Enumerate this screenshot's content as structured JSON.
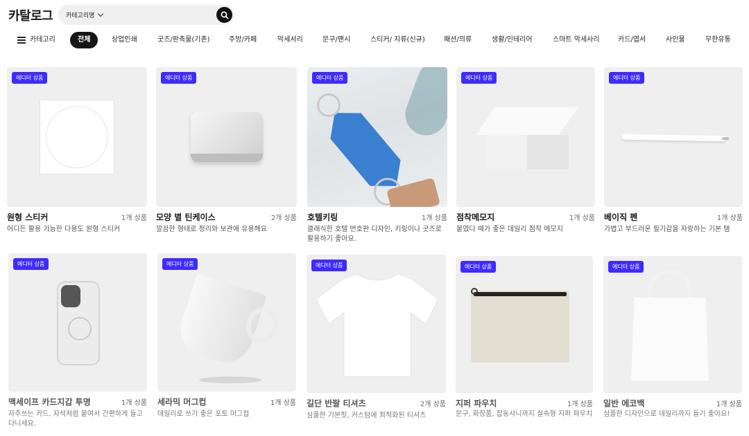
{
  "header": {
    "logo": "카탈로그",
    "search": {
      "category_label": "카테고리명"
    }
  },
  "nav": {
    "category_label": "카테고리",
    "items": [
      "전체",
      "상업인쇄",
      "굿즈/판촉물(기존)",
      "주방/카페",
      "악세서리",
      "문구/팬시",
      "스티커/ 지류(신규)",
      "패션/의류",
      "생활/인테리어",
      "스마트 악세사리",
      "카드/엽서",
      "사인물",
      "무한유통"
    ]
  },
  "products": [
    {
      "badge": "에디터 상품",
      "name": "원형 스티커",
      "count": "1개 상품",
      "desc": "어디든 활용 가능한 다용도 원형 스티커"
    },
    {
      "badge": "에디터 상품",
      "name": "모양 별 틴케이스",
      "count": "2개 상품",
      "desc": "깔끔한 형태로 정리와 보관에 유용해요"
    },
    {
      "badge": "에디터 상품",
      "name": "호텔키링",
      "count": "1개 상품",
      "desc": "클래식한 호텔 번호판 디자인, 키링이나 굿즈로 활용하기 좋아요."
    },
    {
      "badge": "에디터 상품",
      "name": "점착메모지",
      "count": "1개 상품",
      "desc": "붙였다 떼가 좋은 데일리 점착 메모지"
    },
    {
      "badge": "에디터 상품",
      "name": "베이직 펜",
      "count": "1개 상품",
      "desc": "가볍고 부드러운 필기감을 자랑하는 기본 템"
    },
    {
      "badge": "에디터 상품",
      "name": "맥세이프 카드지갑 투명",
      "count": "1개 상품",
      "desc": "자주쓰는 카드, 자석처럼 붙여서 간편하게 들고 다니세요."
    },
    {
      "badge": "에디터 상품",
      "name": "세라믹 머그컵",
      "count": "1개 상품",
      "desc": "데일리로 쓰기 좋은 포토 머그컵"
    },
    {
      "badge": "에디터 상품",
      "name": "길단 반팔 티셔츠",
      "count": "2개 상품",
      "desc": "심플한 기본핏, 커스텀에 최적화된 티셔츠"
    },
    {
      "badge": "에디터 상품",
      "name": "지퍼 파우치",
      "count": "1개 상품",
      "desc": "문구, 화장품, 잡동사니까지 실속형 지퍼 파우치"
    },
    {
      "badge": "에디터 상품",
      "name": "일반 에코백",
      "count": "1개 상품",
      "desc": "심플한 디자인으로 데일리까지 들기 좋아요!"
    }
  ],
  "colors": {
    "badge": "#3d2bff",
    "active_tab": "#161616",
    "card_bg": "#efefef",
    "keyring": "#3a7fd0"
  },
  "icons": {
    "menu": "hamburger-icon",
    "search": "search-icon",
    "dropdown": "chevron-down-icon"
  }
}
